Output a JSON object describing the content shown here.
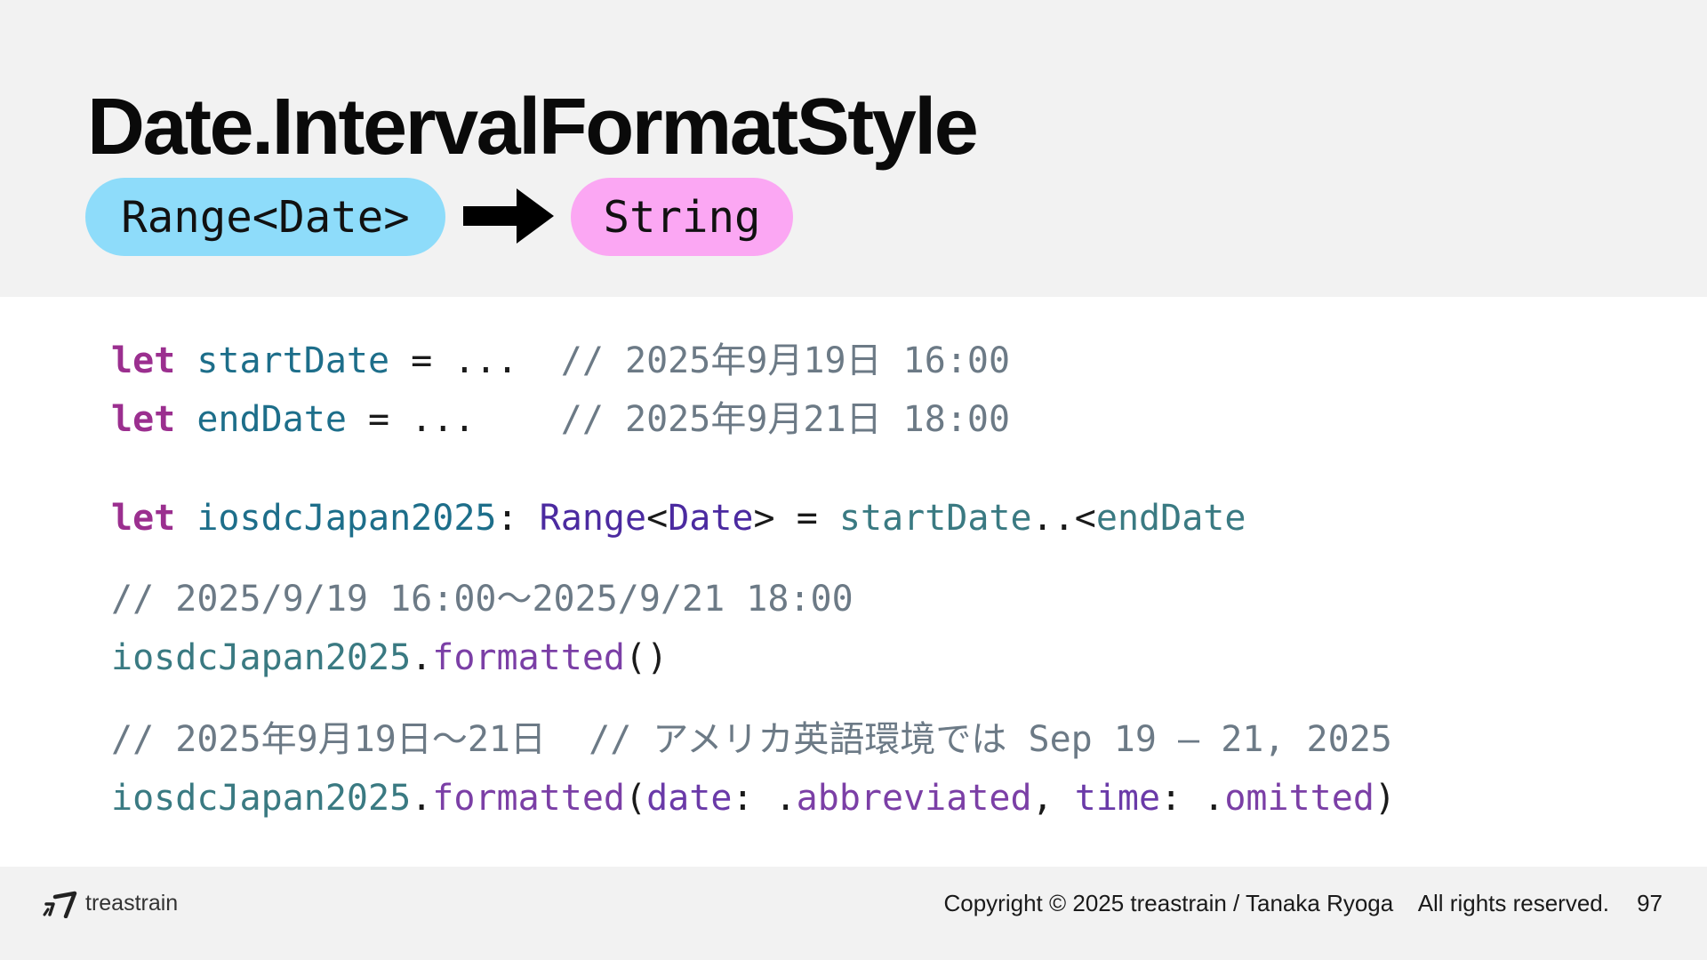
{
  "slide": {
    "title": "Date.IntervalFormatStyle",
    "input_type": "Range<Date>",
    "output_type": "String",
    "icons": {
      "arrow": "right-arrow-icon",
      "logo": "treastrain-logo-icon"
    }
  },
  "code": {
    "l1": {
      "kw": "let",
      "name": "startDate",
      "rest": " = ...",
      "comment": "// 2025年9月19日 16:00"
    },
    "l2": {
      "kw": "let",
      "name": "endDate",
      "rest": " = ...",
      "comment": "// 2025年9月21日 18:00"
    },
    "l3": {
      "kw": "let",
      "name": "iosdcJapan2025",
      "colon": ": ",
      "type1": "Range",
      "lt": "<",
      "type2": "Date",
      "gt": ">",
      "eq": " = ",
      "start": "startDate",
      "op": "..<",
      "end": "endDate"
    },
    "l4": {
      "comment": "// 2025/9/19 16:00〜2025/9/21 18:00"
    },
    "l5": {
      "obj": "iosdcJapan2025",
      "dot": ".",
      "fn": "formatted",
      "parens": "()"
    },
    "l6": {
      "comment1": "// 2025年9月19日〜21日",
      "comment2": "// アメリカ英語環境では Sep 19 – 21, 2025"
    },
    "l7": {
      "obj": "iosdcJapan2025",
      "dot": ".",
      "fn": "formatted",
      "open": "(",
      "p1": "date",
      "c1": ": .",
      "v1": "abbreviated",
      "sep": ", ",
      "p2": "time",
      "c2": ": .",
      "v2": "omitted",
      "close": ")"
    }
  },
  "footer": {
    "brand": "treastrain",
    "copyright": "Copyright © 2025 treastrain / Tanaka Ryoga    All rights reserved.",
    "page": "97"
  },
  "colors": {
    "header_bg": "#f2f2f2",
    "pill_range": "#8edcfa",
    "pill_string": "#fba7f3",
    "keyword": "#9b2f8f",
    "comment": "#6c7a86"
  }
}
